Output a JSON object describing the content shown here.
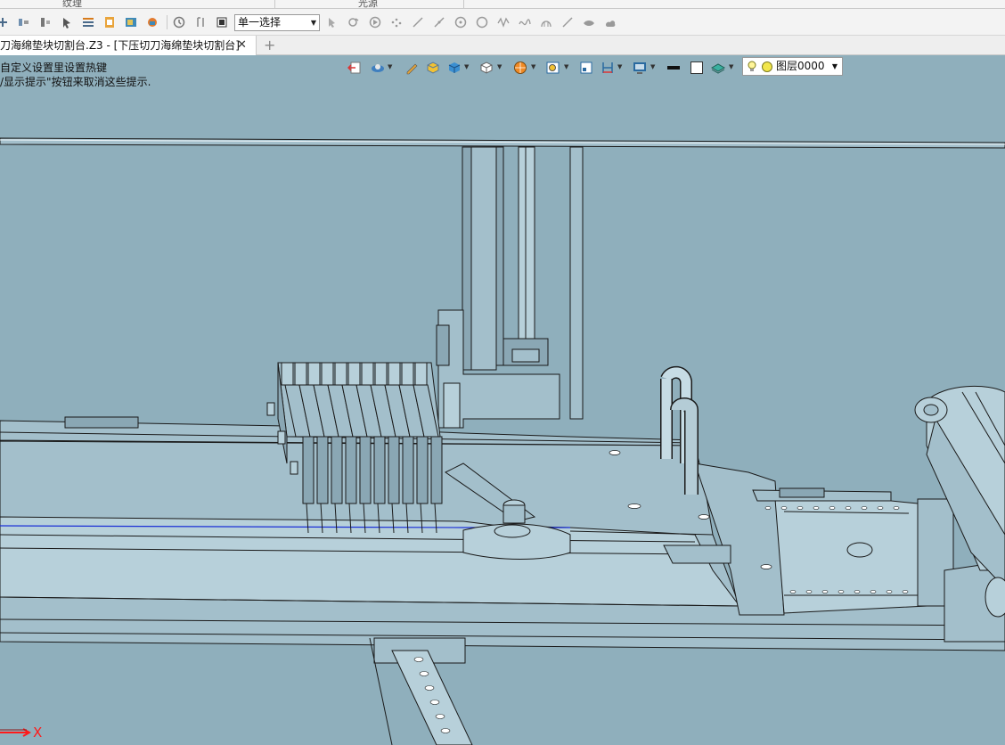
{
  "ribbon": {
    "labels": [
      "纹理",
      "光源"
    ]
  },
  "toolbar": {
    "selection_mode": "单一选择",
    "icons": [
      "axis-icon",
      "pattern-icon",
      "stack-icon",
      "cursor-icon",
      "list-icon",
      "document-icon",
      "export-icon",
      "render-icon",
      "history-icon",
      "bracket-icon",
      "stop-icon",
      "pick-arrow-icon",
      "filter-icon",
      "play-icon",
      "points-icon",
      "line-icon",
      "slash-line-icon",
      "circle-dot-icon",
      "circle-icon",
      "wave-icon",
      "spline-icon",
      "arc-icon",
      "diagonal-icon",
      "eye-icon",
      "cloud-icon"
    ]
  },
  "tabs": {
    "active_label": "刀海绵垫块切割台.Z3 - [下压切刀海绵垫块切割台]",
    "close": "✕",
    "new_tab": "+"
  },
  "hints": {
    "line1": "自定义设置里设置热键",
    "line2": "/显示提示\"按钮来取消这些提示."
  },
  "view_toolbar": {
    "icons": [
      "exit-sketch-icon",
      "view-orient-icon",
      "pencil-icon",
      "shaded-solid-icon",
      "cube-view-icon",
      "iso-cube-icon",
      "render-mode-icon",
      "zoom-box-icon",
      "panel-icon",
      "dimension-icon",
      "display-icon",
      "color-black-icon",
      "color-white-icon",
      "layer-visibility-icon"
    ]
  },
  "layer": {
    "name": "图层0000"
  },
  "axis": {
    "x_label": "X"
  },
  "colors": {
    "background": "#8fafbc",
    "part_fill": "#9fbbc7",
    "outline": "#1a1a1a",
    "axis_red": "#ff1a1a",
    "edge_blue": "#1b2fd6"
  }
}
